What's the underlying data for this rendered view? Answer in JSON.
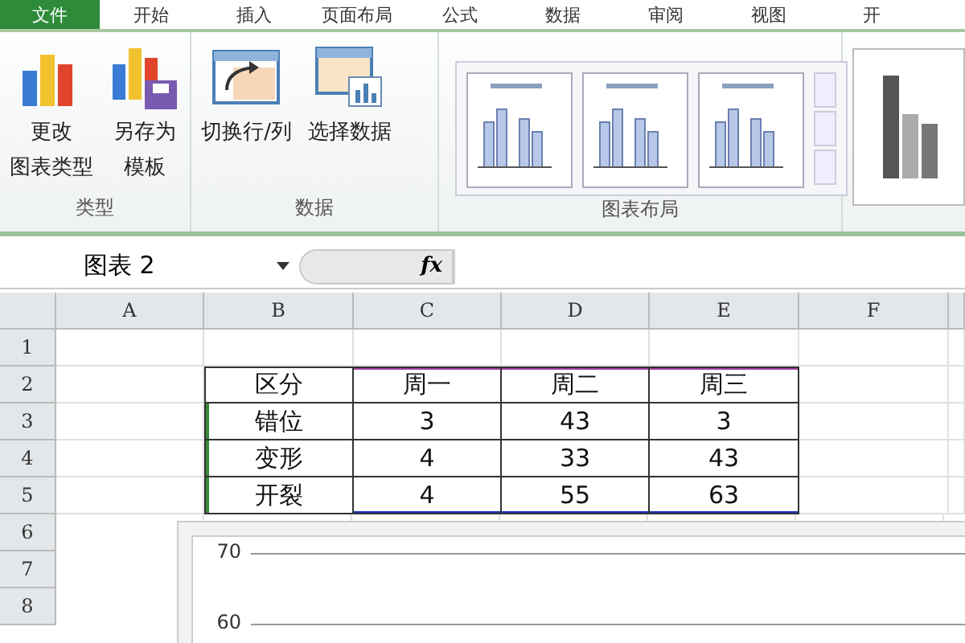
{
  "ribbon_tabs": [
    {
      "label": "文件",
      "selected": true
    },
    {
      "label": "开始",
      "selected": false
    },
    {
      "label": "插入",
      "selected": false
    },
    {
      "label": "页面布局",
      "selected": false
    },
    {
      "label": "公式",
      "selected": false
    },
    {
      "label": "数据",
      "selected": false
    },
    {
      "label": "审阅",
      "selected": false
    },
    {
      "label": "视图",
      "selected": false
    },
    {
      "label": "开",
      "selected": false
    }
  ],
  "ribbon_groups": [
    {
      "label": "类型",
      "kind": "buttons",
      "buttons": [
        {
          "kind": "chart",
          "lines": [
            "更改",
            "图表类型"
          ]
        },
        {
          "kind": "save",
          "lines": [
            "另存为",
            "模板"
          ]
        }
      ]
    },
    {
      "label": "数据",
      "kind": "buttons",
      "buttons": [
        {
          "kind": "switch",
          "lines": [
            "切换行/列"
          ]
        },
        {
          "kind": "select",
          "lines": [
            "选择数据"
          ]
        }
      ]
    },
    {
      "label": "图表布局",
      "kind": "gallery"
    }
  ],
  "name_box": "图表 2",
  "formula_label": "fx",
  "columns": [
    "A",
    "B",
    "C",
    "D",
    "E",
    "F"
  ],
  "row_numbers": [
    "1",
    "2",
    "3",
    "4",
    "5",
    "6",
    "7",
    "8"
  ],
  "table": {
    "header": [
      "区分",
      "周一",
      "周二",
      "周三"
    ],
    "rows": [
      [
        "错位",
        "3",
        "43",
        "3"
      ],
      [
        "变形",
        "4",
        "33",
        "43"
      ],
      [
        "开裂",
        "4",
        "55",
        "63"
      ]
    ]
  },
  "chart": {
    "y_tick_labels": [
      "70",
      "60"
    ]
  }
}
